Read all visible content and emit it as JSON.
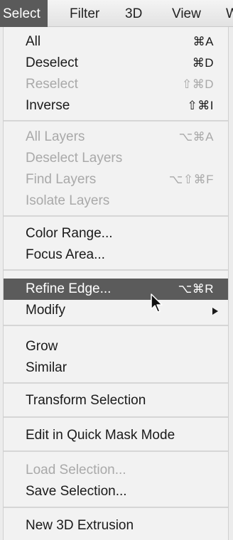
{
  "menubar": {
    "items": [
      "Select",
      "Filter",
      "3D",
      "View",
      "W"
    ],
    "active_index": 0
  },
  "menu": {
    "groups": [
      {
        "items": [
          {
            "label": "All",
            "shortcut": "⌘A",
            "enabled": true
          },
          {
            "label": "Deselect",
            "shortcut": "⌘D",
            "enabled": true
          },
          {
            "label": "Reselect",
            "shortcut": "⇧⌘D",
            "enabled": false
          },
          {
            "label": "Inverse",
            "shortcut": "⇧⌘I",
            "enabled": true
          }
        ]
      },
      {
        "items": [
          {
            "label": "All Layers",
            "shortcut": "⌥⌘A",
            "enabled": false
          },
          {
            "label": "Deselect Layers",
            "shortcut": "",
            "enabled": false
          },
          {
            "label": "Find Layers",
            "shortcut": "⌥⇧⌘F",
            "enabled": false
          },
          {
            "label": "Isolate Layers",
            "shortcut": "",
            "enabled": false
          }
        ]
      },
      {
        "items": [
          {
            "label": "Color Range...",
            "shortcut": "",
            "enabled": true
          },
          {
            "label": "Focus Area...",
            "shortcut": "",
            "enabled": true
          }
        ]
      },
      {
        "items": [
          {
            "label": "Refine Edge...",
            "shortcut": "⌥⌘R",
            "enabled": true,
            "highlighted": true
          },
          {
            "label": "Modify",
            "shortcut": "",
            "enabled": true,
            "submenu": true
          }
        ]
      },
      {
        "items": [
          {
            "label": "Grow",
            "shortcut": "",
            "enabled": true
          },
          {
            "label": "Similar",
            "shortcut": "",
            "enabled": true
          }
        ]
      },
      {
        "items": [
          {
            "label": "Transform Selection",
            "shortcut": "",
            "enabled": true
          }
        ]
      },
      {
        "items": [
          {
            "label": "Edit in Quick Mask Mode",
            "shortcut": "",
            "enabled": true
          }
        ]
      },
      {
        "items": [
          {
            "label": "Load Selection...",
            "shortcut": "",
            "enabled": false
          },
          {
            "label": "Save Selection...",
            "shortcut": "",
            "enabled": true
          }
        ]
      },
      {
        "items": [
          {
            "label": "New 3D Extrusion",
            "shortcut": "",
            "enabled": true
          }
        ]
      }
    ]
  },
  "colors": {
    "highlight": "#5b5b5b",
    "disabled_text": "#a9a9a9",
    "menu_background": "#f2f2f2"
  }
}
